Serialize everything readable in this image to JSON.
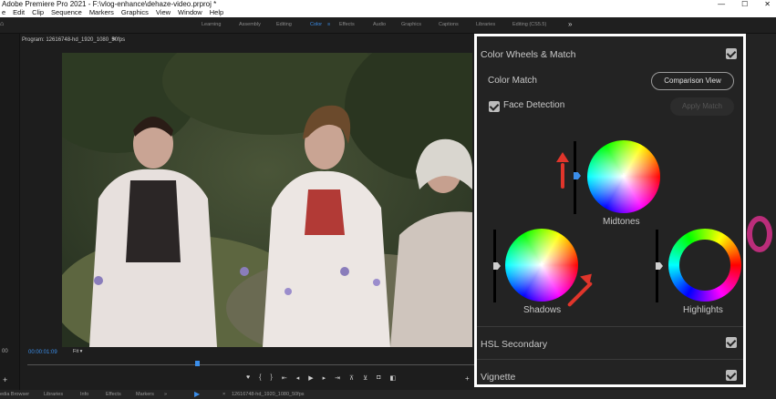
{
  "window": {
    "title": "Adobe Premiere Pro 2021 - F:\\vlog-enhance\\dehaze-video.prproj *",
    "controls": [
      "—",
      "☐",
      "✕"
    ]
  },
  "menu": [
    "e",
    "Edit",
    "Clip",
    "Sequence",
    "Markers",
    "Graphics",
    "View",
    "Window",
    "Help"
  ],
  "workspaces": [
    "Learning",
    "Assembly",
    "Editing",
    "Color",
    "Effects",
    "Audio",
    "Graphics",
    "Captions",
    "Libraries",
    "Editing (CS5.5)",
    "»"
  ],
  "program": {
    "title": "Program: 12616748-hd_1920_1080_50fps",
    "timecode": "00:00:01:09",
    "zoom": "Fit",
    "playhead_fraction": 0.38
  },
  "bottom_tabs": [
    "edia Browser",
    "Libraries",
    "Info",
    "Effects",
    "Markers"
  ],
  "sequence_tab": "12616748-hd_1920_1080_50fps",
  "left_timecode": "00",
  "lumetri": {
    "section_title": "Color Wheels & Match",
    "color_match_label": "Color Match",
    "comparison_button": "Comparison View",
    "face_detection_label": "Face Detection",
    "apply_match_button": "Apply Match",
    "midtones_label": "Midtones",
    "shadows_label": "Shadows",
    "highlights_label": "Highlights",
    "hsl_label": "HSL Secondary",
    "vignette_label": "Vignette"
  },
  "colors": {
    "accent": "#3b8eea",
    "annotation": "#e0352b",
    "panel_bg": "#232323",
    "panel_border": "#ffffff"
  }
}
